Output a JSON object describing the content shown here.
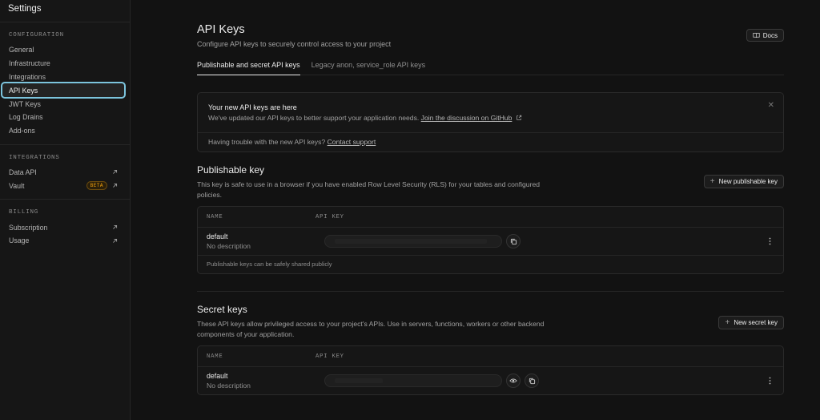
{
  "sidebar": {
    "title": "Settings",
    "sections": [
      {
        "heading": "CONFIGURATION",
        "items": [
          {
            "label": "General"
          },
          {
            "label": "Infrastructure"
          },
          {
            "label": "Integrations"
          },
          {
            "label": "API Keys",
            "active": true
          },
          {
            "label": "JWT Keys"
          },
          {
            "label": "Log Drains"
          },
          {
            "label": "Add-ons"
          }
        ]
      },
      {
        "heading": "INTEGRATIONS",
        "items": [
          {
            "label": "Data API",
            "icon": "arrow-up-right-icon"
          },
          {
            "label": "Vault",
            "badge": "BETA",
            "icon": "arrow-up-right-icon"
          }
        ]
      },
      {
        "heading": "BILLING",
        "items": [
          {
            "label": "Subscription",
            "icon": "arrow-up-right-icon"
          },
          {
            "label": "Usage",
            "icon": "arrow-up-right-icon"
          }
        ]
      }
    ]
  },
  "header": {
    "title": "API Keys",
    "subtitle": "Configure API keys to securely control access to your project",
    "docs_label": "Docs"
  },
  "tabs": [
    {
      "label": "Publishable and secret API keys",
      "active": true
    },
    {
      "label": "Legacy anon, service_role API keys",
      "active": false
    }
  ],
  "notice": {
    "title": "Your new API keys are here",
    "body": "We've updated our API keys to better support your application needs.",
    "link": "Join the discussion on GitHub",
    "footer_text": "Having trouble with the new API keys?",
    "footer_link": "Contact support"
  },
  "publishable": {
    "title": "Publishable key",
    "description": "This key is safe to use in a browser if you have enabled Row Level Security (RLS) for your tables and configured policies.",
    "new_button": "New publishable key",
    "columns": [
      "NAME",
      "API KEY"
    ],
    "rows": [
      {
        "name": "default",
        "description": "No description"
      }
    ],
    "footer": "Publishable keys can be safely shared publicly"
  },
  "secret": {
    "title": "Secret keys",
    "description": "These API keys allow privileged access to your project's APIs. Use in servers, functions, workers or other backend components of your application.",
    "new_button": "New secret key",
    "columns": [
      "NAME",
      "API KEY"
    ],
    "rows": [
      {
        "name": "default",
        "description": "No description"
      }
    ]
  },
  "colors": {
    "background": "#121212",
    "sidebar": "#161616",
    "active_outline": "#7cc4dd",
    "beta_badge": "#f1a10d"
  }
}
